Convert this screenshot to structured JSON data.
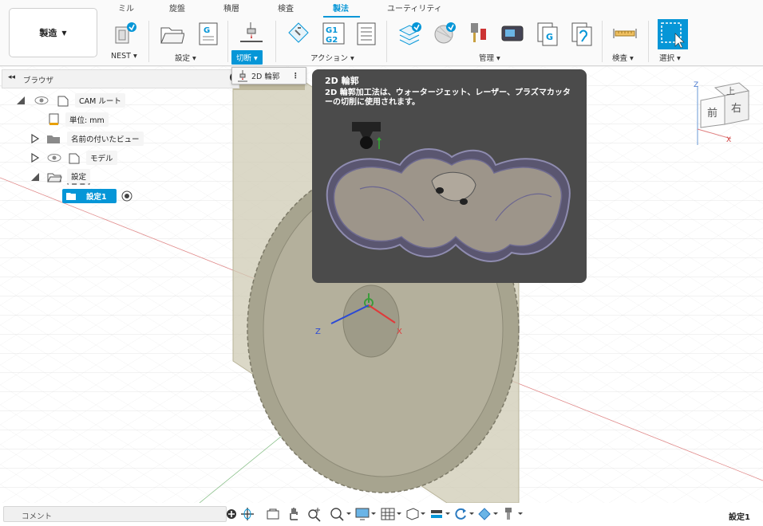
{
  "toolbar": {
    "workspace": "製造",
    "workspace_arrow": "▼",
    "tabs": [
      "ミル",
      "旋盤",
      "積層",
      "検査",
      "製法",
      "ユーティリティ"
    ],
    "active_tab": "製法",
    "groups": {
      "nest": "NEST ▾",
      "setup": "設定 ▾",
      "cutting": "切断 ▾",
      "actions": "アクション ▾",
      "manage": "管理 ▾",
      "inspect": "検査 ▾",
      "select": "選択 ▾"
    },
    "accent": "#0696d7"
  },
  "browser": {
    "title": "ブラウザ",
    "collapse_icon": "◂◂",
    "items": {
      "cam_root": "CAM ルート",
      "units": "単位: mm",
      "named_views": "名前の付いたビュー",
      "model": "モデル",
      "setups": "設定",
      "setup1": "設定1"
    }
  },
  "dropdown": {
    "item_label": "2D 輪郭",
    "more_icon": "⋮"
  },
  "tooltip": {
    "title": "2D 輪郭",
    "body": "2D 輪郭加工法は、ウォータージェット、レーザー、プラズマカッターの切削に使用されます。"
  },
  "viewcube": {
    "top": "上",
    "front": "前",
    "right": "右",
    "axis_z": "Z",
    "axis_x": "X"
  },
  "triad": {
    "z": "Z",
    "x": "X"
  },
  "statusbar": {
    "comment": "コメント",
    "active_setup": "設定1"
  }
}
